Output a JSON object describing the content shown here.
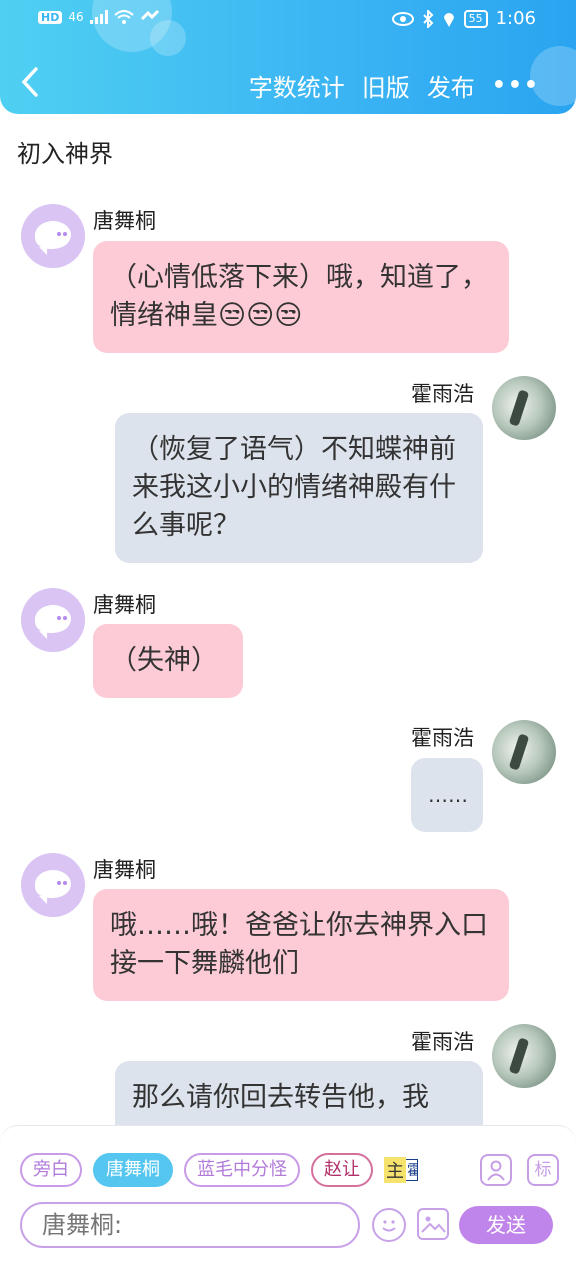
{
  "status": {
    "hd": "HD",
    "network": "46",
    "battery": "55",
    "time": "1:06"
  },
  "nav": {
    "back_icon": "chevron-left-icon",
    "word_count": "字数统计",
    "old_version": "旧版",
    "publish": "发布",
    "more": "•••"
  },
  "story_title": "初入神界",
  "messages": [
    {
      "side": "left",
      "name": "唐舞桐",
      "text": "（心情低落下来）哦，知道了，情绪神皇😒😒😒"
    },
    {
      "side": "right",
      "name": "霍雨浩",
      "text": "（恢复了语气）不知蝶神前来我这小小的情绪神殿有什么事呢？"
    },
    {
      "side": "left",
      "name": "唐舞桐",
      "text": "（失神）"
    },
    {
      "side": "right",
      "name": "霍雨浩",
      "text": "……"
    },
    {
      "side": "left",
      "name": "唐舞桐",
      "text": "哦……哦！爸爸让你去神界入口接一下舞麟他们"
    },
    {
      "side": "right",
      "name": "霍雨浩",
      "text": "那么请你回去转告他，我"
    }
  ],
  "roles": [
    "旁白",
    "唐舞桐",
    "蓝毛中分怪",
    "赵让"
  ],
  "mini_tag": {
    "a": "主",
    "b": "霍"
  },
  "icons": {
    "person": "person-icon",
    "tag": "标"
  },
  "input": {
    "placeholder": "唐舞桐:"
  },
  "send_label": "发送",
  "colors": {
    "accent": "#3cb6f3",
    "left_bubble": "#fdcbd6",
    "right_bubble": "#dde3ec",
    "purple": "#c085ea"
  }
}
